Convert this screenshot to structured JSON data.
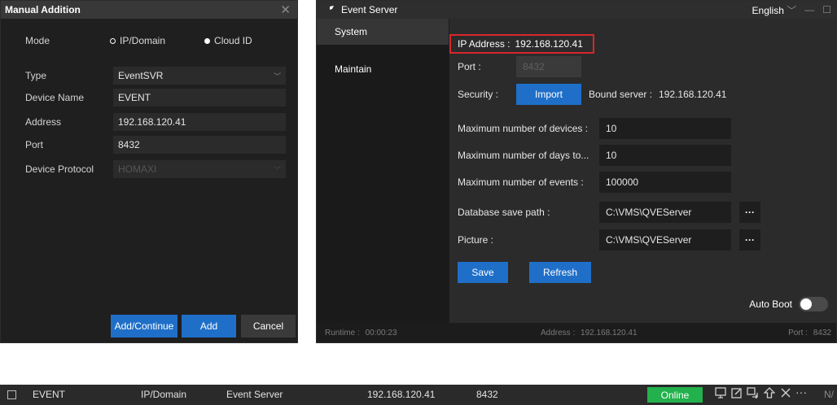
{
  "manual_addition": {
    "title": "Manual Addition",
    "close_glyph": "✕",
    "mode_label": "Mode",
    "mode_options": [
      "IP/Domain",
      "Cloud ID"
    ],
    "type_label": "Type",
    "type_value": "EventSVR",
    "device_name_label": "Device Name",
    "device_name_value": "EVENT",
    "address_label": "Address",
    "address_value": "192.168.120.41",
    "port_label": "Port",
    "port_value": "8432",
    "protocol_label": "Device Protocol",
    "protocol_value": "HOMAXI",
    "buttons": {
      "add_continue": "Add/Continue",
      "add": "Add",
      "cancel": "Cancel"
    }
  },
  "event_server": {
    "title": "Event Server",
    "language": "English",
    "nav": [
      "System",
      "Maintain"
    ],
    "ip_address_label": "IP Address :",
    "ip_address_value": "192.168.120.41",
    "port_label": "Port :",
    "port_value": "8432",
    "security_label": "Security :",
    "import_label": "Import",
    "bound_server_label": "Bound server :",
    "bound_server_value": "192.168.120.41",
    "max_devices_label": "Maximum number of devices :",
    "max_devices_value": "10",
    "max_days_label": "Maximum number of days to...",
    "max_days_value": "10",
    "max_events_label": "Maximum number of events :",
    "max_events_value": "100000",
    "db_path_label": "Database save path :",
    "db_path_value": "C:\\VMS\\QVEServer",
    "picture_label": "Picture :",
    "picture_value": "C:\\VMS\\QVEServer",
    "more_glyph": "···",
    "save_label": "Save",
    "refresh_label": "Refresh",
    "auto_boot_label": "Auto Boot",
    "auto_boot_on": false,
    "status": {
      "runtime_label": "Runtime :",
      "runtime_value": "00:00:23",
      "address_label": "Address :",
      "address_value": "192.168.120.41",
      "port_label": "Port :",
      "port_value": "8432"
    }
  },
  "device_row": {
    "name": "EVENT",
    "mode": "IP/Domain",
    "type": "Event Server",
    "address": "192.168.120.41",
    "port": "8432",
    "status": "Online",
    "status_color": "#22b14c",
    "trailing": "N/",
    "action_icons": [
      "monitor-icon",
      "edit-icon",
      "replace-icon",
      "upgrade-icon",
      "delete-icon",
      "more-icon"
    ]
  },
  "colors": {
    "accent_blue": "#1f6fc9",
    "highlight_red": "#d9262c",
    "online_green": "#22b14c"
  }
}
